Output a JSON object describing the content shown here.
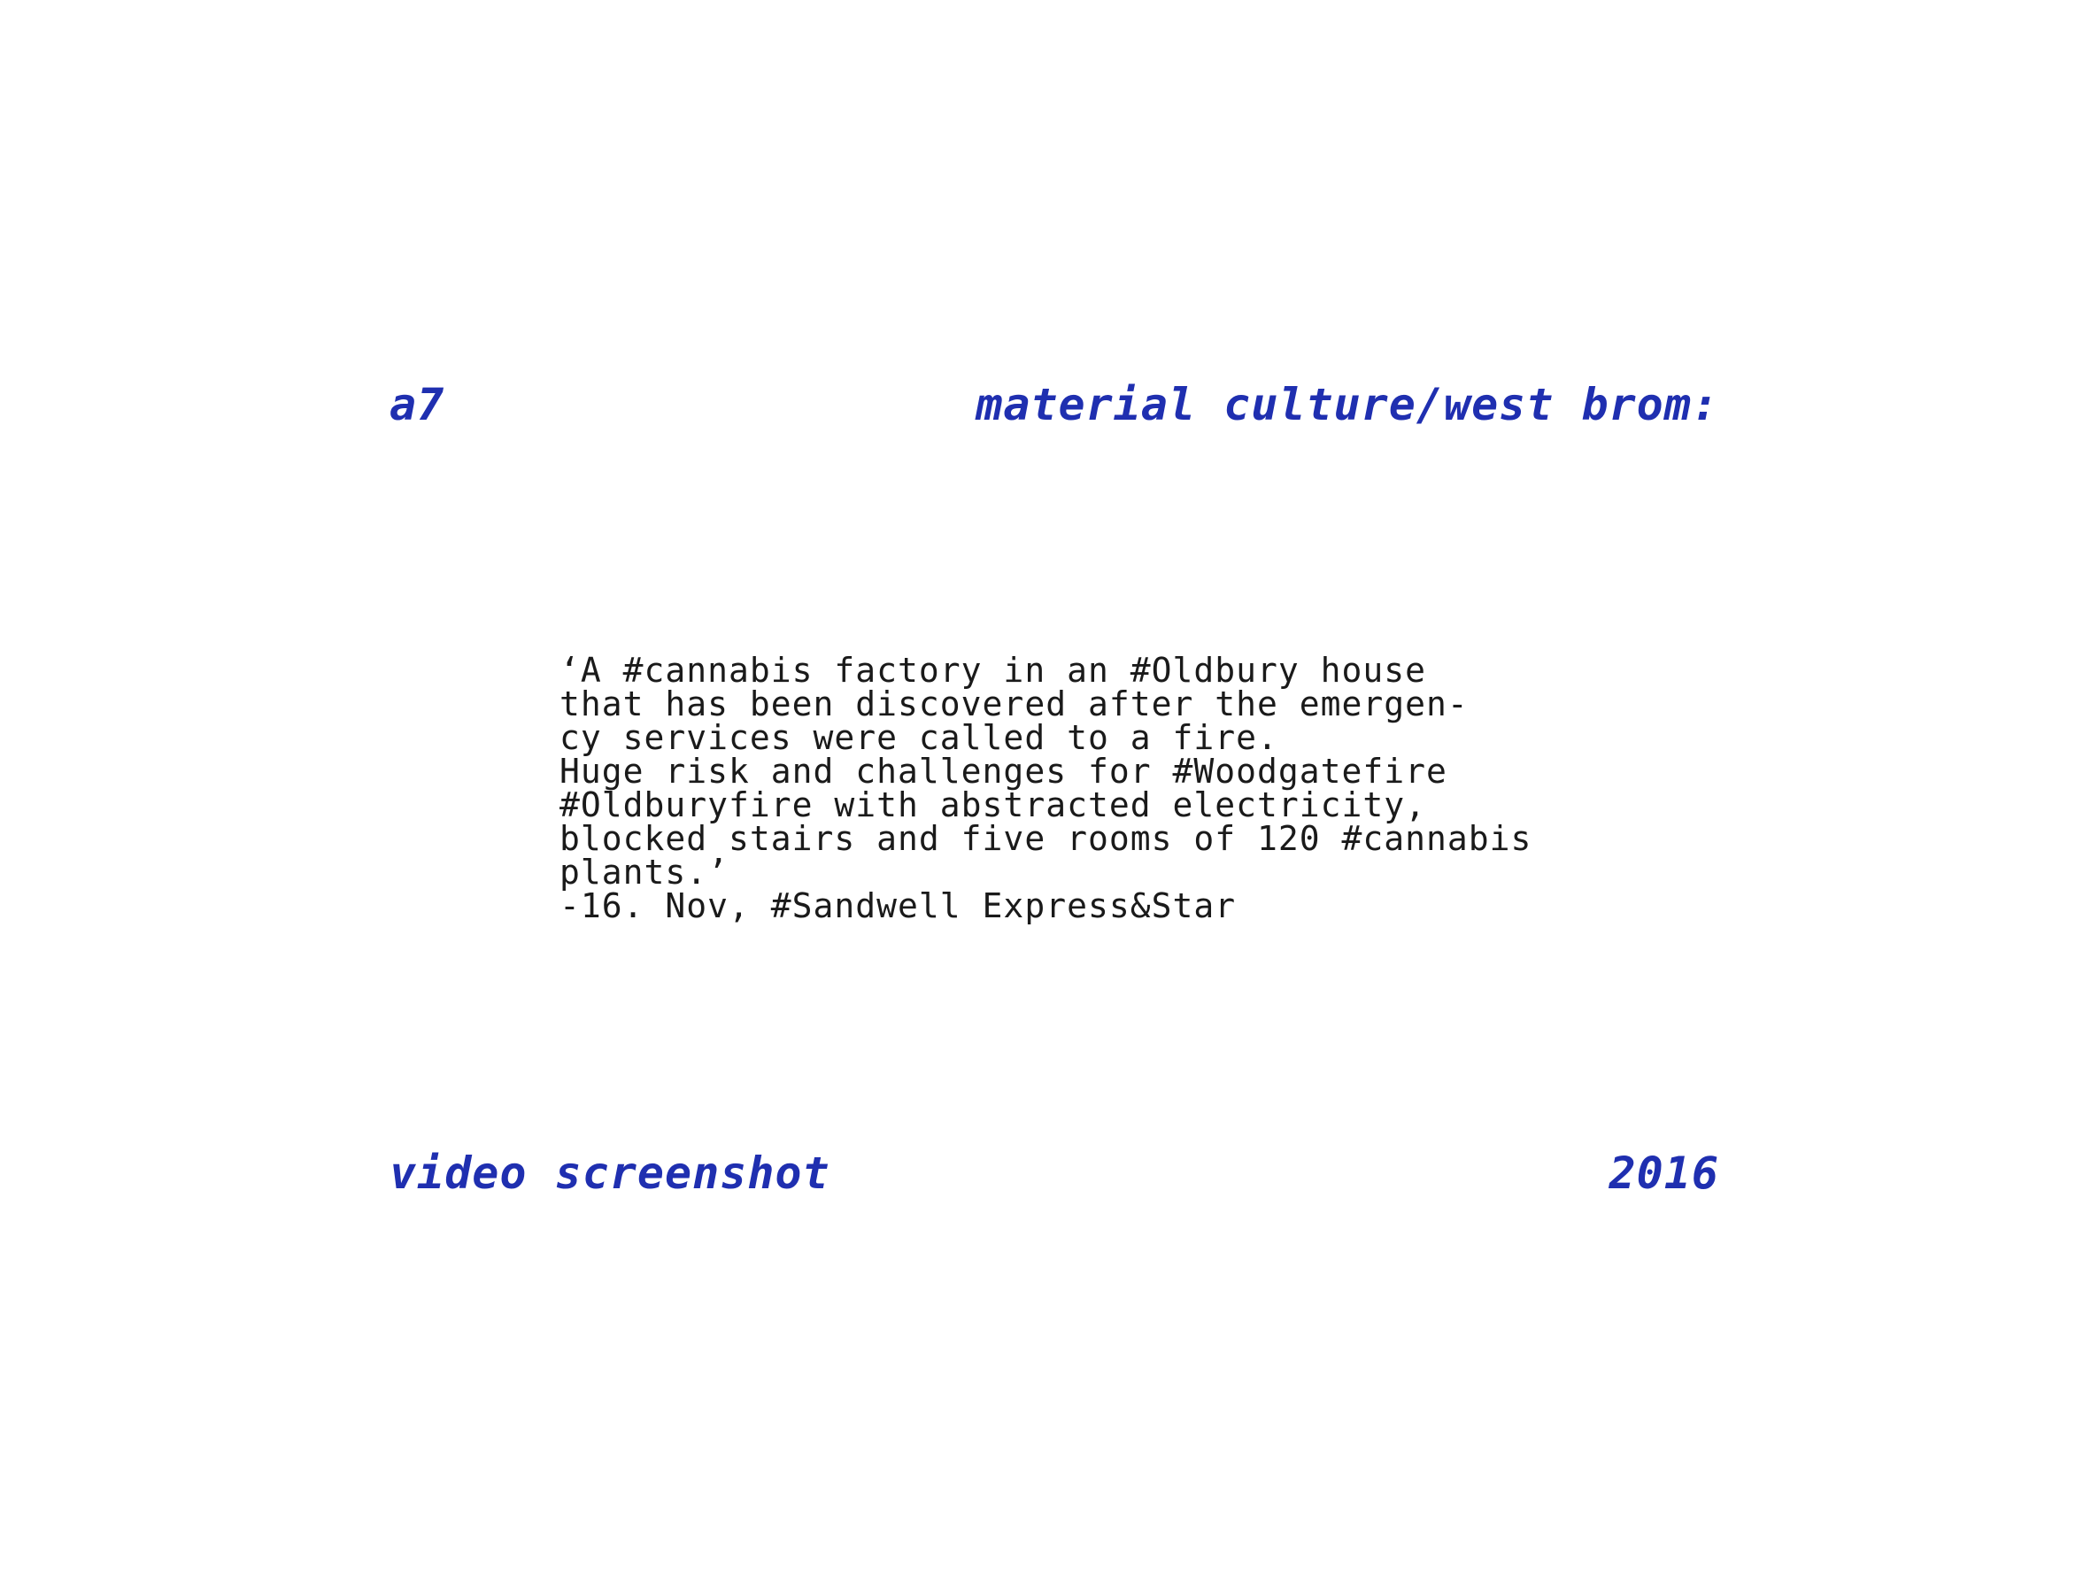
{
  "header": {
    "code": "a7",
    "title": "material culture/west brom:"
  },
  "quote": {
    "lines": [
      "‘A #cannabis factory in an #Oldbury house",
      "that has been discovered after the emergen-",
      "cy services were called to a fire.",
      "Huge risk and challenges for #Woodgatefire",
      "#Oldburyfire with abstracted electricity,",
      "blocked stairs and five rooms of 120 #cannabis",
      "plants.’",
      "-16. Nov, #Sandwell Express&Star"
    ]
  },
  "footer": {
    "medium": "video screenshot",
    "year": "2016"
  },
  "colors": {
    "accent": "#1f2fb0",
    "text": "#1a1a1a",
    "background": "#ffffff"
  }
}
